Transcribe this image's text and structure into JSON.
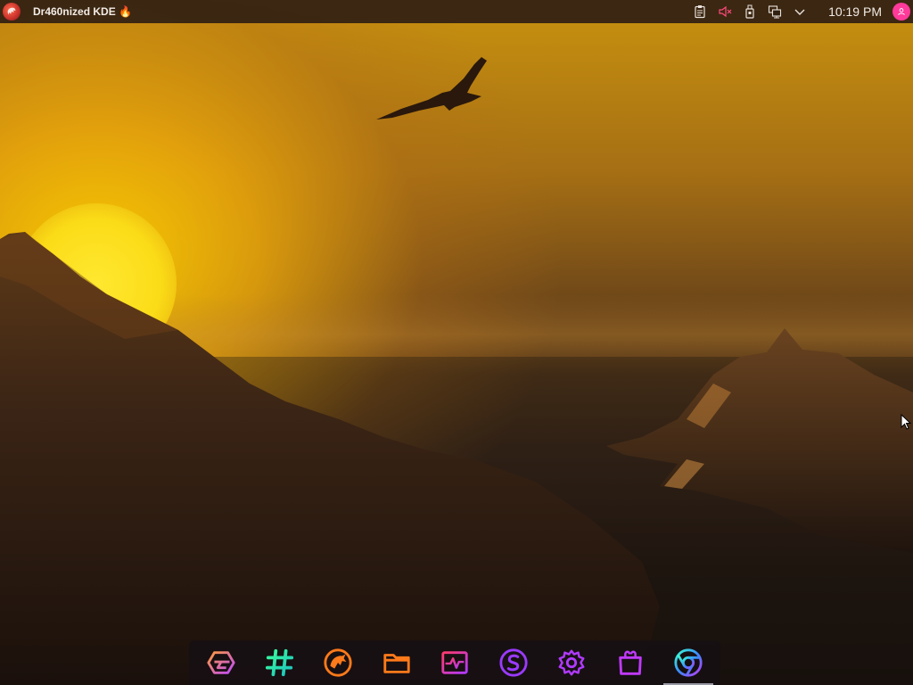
{
  "topbar": {
    "window_title": "Dr460nized KDE 🔥",
    "clock": "10:19 PM",
    "tray_icons": [
      "clipboard-icon",
      "volume-muted-icon",
      "usb-device-icon",
      "network-icon",
      "expand-arrow-icon"
    ],
    "avatar_icon": "user-avatar-icon"
  },
  "dock": {
    "items": [
      {
        "name": "garuda-launcher",
        "icon": "garuda-icon"
      },
      {
        "name": "hashtag-app",
        "icon": "hashtag-icon"
      },
      {
        "name": "dragon-app",
        "icon": "dragon-icon"
      },
      {
        "name": "file-manager",
        "icon": "folder-icon"
      },
      {
        "name": "system-monitor",
        "icon": "activity-monitor-icon"
      },
      {
        "name": "s-app",
        "icon": "s-app-icon"
      },
      {
        "name": "settings",
        "icon": "gear-icon"
      },
      {
        "name": "software-store",
        "icon": "store-bag-icon"
      },
      {
        "name": "web-browser",
        "icon": "browser-icon",
        "active": true
      }
    ]
  },
  "colors": {
    "dock_active_indicator": "#9a9aa6",
    "avatar": "#ff3a9a",
    "volume_icon": "#ff4a7a"
  }
}
